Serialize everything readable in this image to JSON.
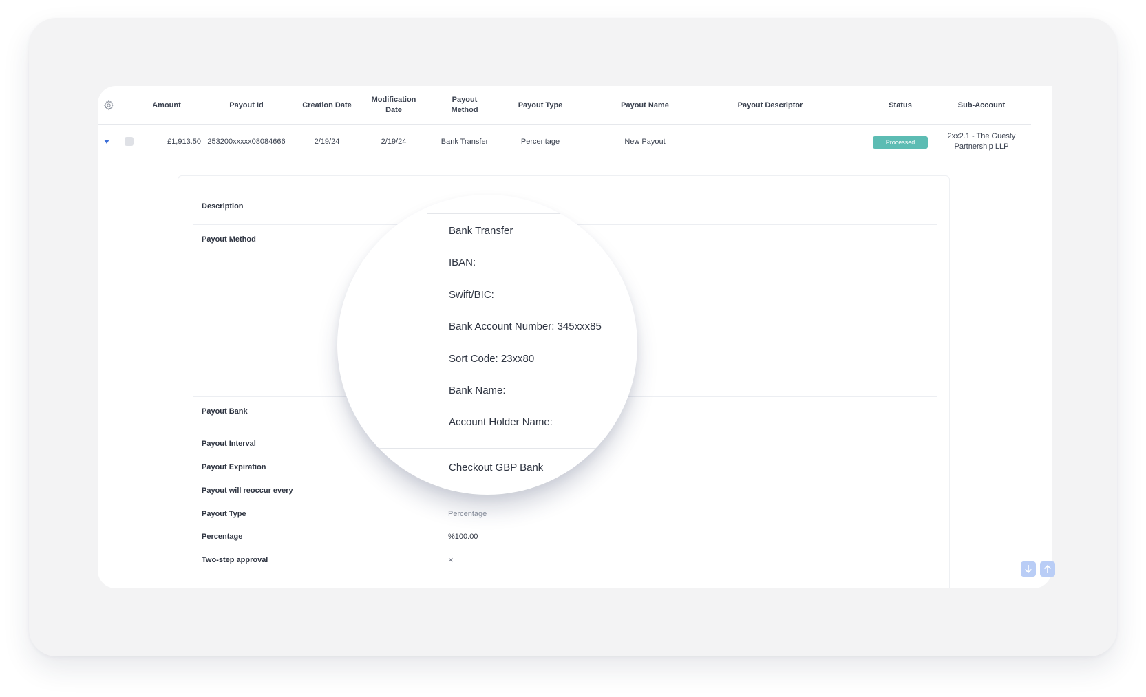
{
  "table": {
    "columns": [
      "Amount",
      "Payout Id",
      "Creation Date",
      "Modification Date",
      "Payout Method",
      "Payout Type",
      "Payout Name",
      "Payout Descriptor",
      "Status",
      "Sub-Account"
    ],
    "headers": {
      "amount": "Amount",
      "payout_id": "Payout Id",
      "creation_date": "Creation Date",
      "modification_date_1": "Modification",
      "modification_date_2": "Date",
      "payout_method_1": "Payout",
      "payout_method_2": "Method",
      "payout_type": "Payout Type",
      "payout_name": "Payout Name",
      "payout_descriptor": "Payout Descriptor",
      "status": "Status",
      "sub_account": "Sub-Account"
    },
    "row": {
      "amount": "£1,913.50",
      "payout_id": "253200xxxxx08084666",
      "creation_date": "2/19/24",
      "modification_date": "2/19/24",
      "payout_method": "Bank Transfer",
      "payout_type": "Percentage",
      "payout_name": "New Payout",
      "payout_descriptor": "",
      "status": "Processed",
      "sub_account_1": "2xx2.1 - The Guesty",
      "sub_account_2": "Partnership LLP"
    }
  },
  "details": {
    "description_label": "Description",
    "payout_method_label": "Payout Method",
    "payout_bank_label": "Payout Bank",
    "payout_interval_label": "Payout Interval",
    "payout_expiration_label": "Payout Expiration",
    "payout_reoccur_label": "Payout will reoccur every",
    "payout_type_label": "Payout Type",
    "payout_type_value": "Percentage",
    "percentage_label": "Percentage",
    "percentage_value": "%100.00",
    "two_step_label": "Two-step approval",
    "two_step_value": "×"
  },
  "magnifier": {
    "method": "Bank Transfer",
    "iban": "IBAN:",
    "swift": "Swift/BIC:",
    "account_number": "Bank Account Number: 345xxx85",
    "sort_code": "Sort Code: 23xx80",
    "bank_name": "Bank Name:",
    "holder_name": "Account Holder Name:",
    "payout_bank": "Checkout GBP Bank"
  },
  "colors": {
    "status_processed": "#5cbcb3",
    "caret": "#3d6fd8",
    "scroll_button": "#b9cdf6"
  },
  "icons": {
    "settings": "gear-icon",
    "expand": "caret-down-icon",
    "scroll_down": "arrow-down-icon",
    "scroll_up": "arrow-up-icon"
  }
}
